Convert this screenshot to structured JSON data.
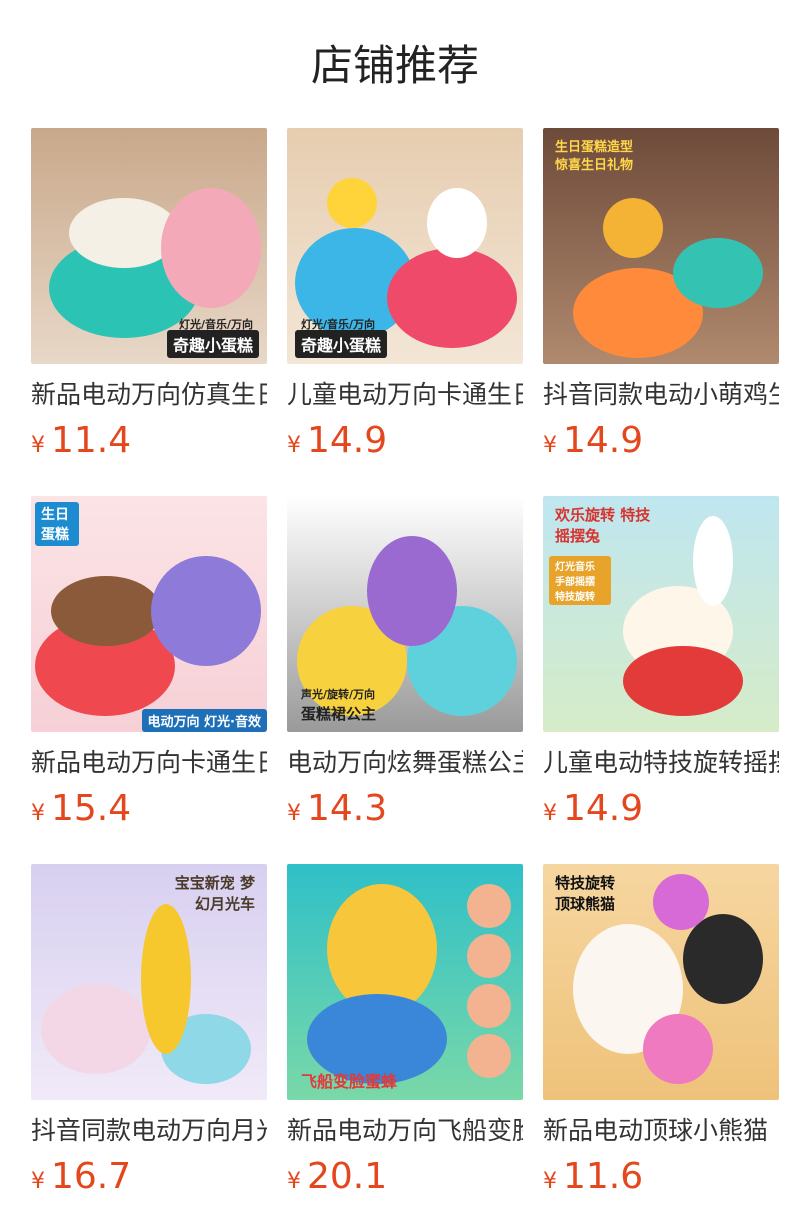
{
  "page": {
    "title": "店铺推荐"
  },
  "products": [
    {
      "name": "新品电动万向仿真生日蛋糕",
      "currency": "¥",
      "price": "11.4",
      "image_label": "奇趣小蛋糕",
      "image_sub": "灯光/音乐/万向"
    },
    {
      "name": "儿童电动万向卡通生日蛋糕",
      "currency": "¥",
      "price": "14.9",
      "image_label": "奇趣小蛋糕",
      "image_sub": "灯光/音乐/万向"
    },
    {
      "name": "抖音同款电动小萌鸡生日蛋糕",
      "currency": "¥",
      "price": "14.9",
      "image_label": "生日蛋糕造型",
      "image_sub": "惊喜生日礼物"
    },
    {
      "name": "新品电动万向卡通生日蛋糕",
      "currency": "¥",
      "price": "15.4",
      "image_label": "生日蛋糕",
      "image_sub": "电动万向 灯光·音效"
    },
    {
      "name": "电动万向炫舞蛋糕公主",
      "currency": "¥",
      "price": "14.3",
      "image_label": "蛋糕裙公主",
      "image_sub": "声光/旋转/万向"
    },
    {
      "name": "儿童电动特技旋转摇摆兔",
      "currency": "¥",
      "price": "14.9",
      "image_label": "欢乐旋转 特技摇摆兔",
      "image_sub": "灯光音乐 手部摇摆 特技旋转"
    },
    {
      "name": "抖音同款电动万向月光车",
      "currency": "¥",
      "price": "16.7",
      "image_label": "宝宝新宠 梦幻月光车",
      "image_sub": ""
    },
    {
      "name": "新品电动万向飞船变脸蜜蜂",
      "currency": "¥",
      "price": "20.1",
      "image_label": "飞船变脸蜜蜂",
      "image_sub": ""
    },
    {
      "name": "新品电动顶球小熊猫",
      "currency": "¥",
      "price": "11.6",
      "image_label": "特技旋转 顶球熊猫",
      "image_sub": ""
    }
  ],
  "colors": {
    "price": "#e4471e",
    "title": "#222222",
    "name": "#333333"
  }
}
